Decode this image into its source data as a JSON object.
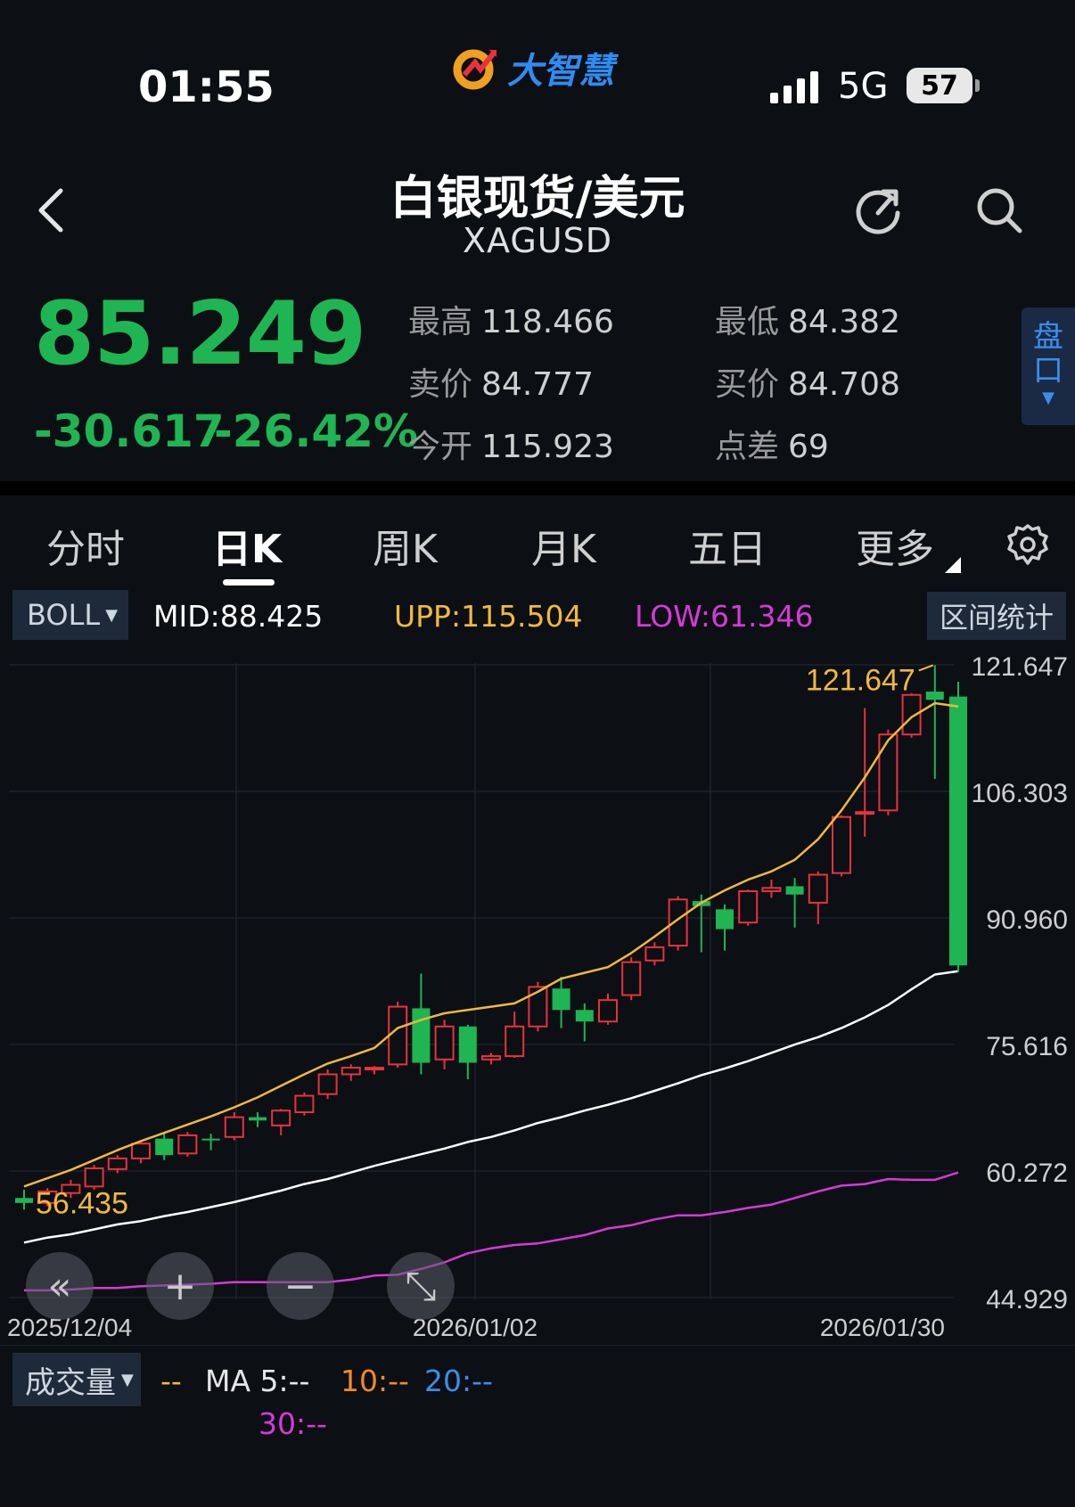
{
  "status": {
    "time": "01:55",
    "network": "5G",
    "battery": "57",
    "app_name": "大智慧"
  },
  "header": {
    "title": "白银现货/美元",
    "symbol": "XAGUSD"
  },
  "quote": {
    "price": "85.249",
    "change": "-30.617",
    "change_pct": "-26.42%",
    "stats": [
      {
        "label": "最高",
        "value": "118.466"
      },
      {
        "label": "最低",
        "value": "84.382"
      },
      {
        "label": "卖价",
        "value": "84.777"
      },
      {
        "label": "买价",
        "value": "84.708"
      },
      {
        "label": "今开",
        "value": "115.923"
      },
      {
        "label": "点差",
        "value": "69"
      }
    ],
    "pankou": [
      "盘",
      "口"
    ],
    "up_color": "#e8323c",
    "down_color": "#1fb553"
  },
  "tabs": [
    "分时",
    "日K",
    "周K",
    "月K",
    "五日",
    "更多"
  ],
  "active_tab": "日K",
  "indicator": {
    "name": "BOLL",
    "mid": "MID:88.425",
    "upp": "UPP:115.504",
    "low": "LOW:61.346",
    "range_stats": "区间统计",
    "colors": {
      "mid": "#ffffff",
      "upp": "#f0b93a",
      "low": "#d63ad6"
    }
  },
  "chart_data": {
    "type": "candlestick",
    "y_ticks": [
      "121.647",
      "106.303",
      "90.960",
      "75.616",
      "60.272",
      "44.929"
    ],
    "ylim": [
      44.929,
      121.647
    ],
    "x_labels": [
      "2025/12/04",
      "2026/01/02",
      "2026/01/30"
    ],
    "max_label": "121.647",
    "min_label": "56.435",
    "candles": [
      {
        "o": 57.0,
        "h": 58.0,
        "l": 55.6,
        "c": 56.4
      },
      {
        "o": 56.4,
        "h": 58.2,
        "l": 56.0,
        "c": 57.8
      },
      {
        "o": 57.6,
        "h": 59.2,
        "l": 57.0,
        "c": 58.6
      },
      {
        "o": 58.4,
        "h": 61.0,
        "l": 58.0,
        "c": 60.6
      },
      {
        "o": 60.5,
        "h": 62.2,
        "l": 60.0,
        "c": 61.8
      },
      {
        "o": 61.8,
        "h": 64.0,
        "l": 61.2,
        "c": 63.6
      },
      {
        "o": 64.2,
        "h": 65.0,
        "l": 61.6,
        "c": 62.2
      },
      {
        "o": 62.4,
        "h": 65.0,
        "l": 62.0,
        "c": 64.6
      },
      {
        "o": 64.2,
        "h": 64.8,
        "l": 62.8,
        "c": 64.0
      },
      {
        "o": 64.4,
        "h": 67.4,
        "l": 64.0,
        "c": 66.8
      },
      {
        "o": 66.8,
        "h": 67.4,
        "l": 65.6,
        "c": 66.4
      },
      {
        "o": 65.8,
        "h": 67.8,
        "l": 64.6,
        "c": 67.6
      },
      {
        "o": 67.4,
        "h": 69.8,
        "l": 67.0,
        "c": 69.4
      },
      {
        "o": 69.6,
        "h": 72.6,
        "l": 69.0,
        "c": 72.0
      },
      {
        "o": 72.0,
        "h": 73.2,
        "l": 71.2,
        "c": 72.8
      },
      {
        "o": 72.6,
        "h": 73.0,
        "l": 72.0,
        "c": 72.8
      },
      {
        "o": 73.2,
        "h": 80.8,
        "l": 72.8,
        "c": 80.2
      },
      {
        "o": 80.0,
        "h": 84.2,
        "l": 72.0,
        "c": 73.4
      },
      {
        "o": 73.8,
        "h": 78.6,
        "l": 72.6,
        "c": 77.8
      },
      {
        "o": 77.8,
        "h": 78.0,
        "l": 71.4,
        "c": 73.4
      },
      {
        "o": 73.8,
        "h": 74.6,
        "l": 73.2,
        "c": 74.2
      },
      {
        "o": 74.2,
        "h": 79.6,
        "l": 74.0,
        "c": 77.8
      },
      {
        "o": 77.8,
        "h": 83.2,
        "l": 77.2,
        "c": 82.6
      },
      {
        "o": 82.4,
        "h": 83.8,
        "l": 77.6,
        "c": 79.8
      },
      {
        "o": 79.8,
        "h": 80.6,
        "l": 76.0,
        "c": 78.4
      },
      {
        "o": 78.4,
        "h": 81.8,
        "l": 78.0,
        "c": 81.0
      },
      {
        "o": 81.6,
        "h": 86.2,
        "l": 81.0,
        "c": 85.6
      },
      {
        "o": 85.8,
        "h": 88.0,
        "l": 85.2,
        "c": 87.4
      },
      {
        "o": 87.6,
        "h": 93.6,
        "l": 87.0,
        "c": 93.2
      },
      {
        "o": 93.0,
        "h": 93.8,
        "l": 86.8,
        "c": 92.4
      },
      {
        "o": 92.0,
        "h": 92.6,
        "l": 87.0,
        "c": 89.6
      },
      {
        "o": 90.4,
        "h": 94.4,
        "l": 90.0,
        "c": 94.2
      },
      {
        "o": 94.2,
        "h": 95.6,
        "l": 93.4,
        "c": 94.6
      },
      {
        "o": 94.8,
        "h": 95.8,
        "l": 89.8,
        "c": 93.8
      },
      {
        "o": 92.8,
        "h": 96.6,
        "l": 90.2,
        "c": 96.2
      },
      {
        "o": 96.4,
        "h": 103.4,
        "l": 96.0,
        "c": 103.2
      },
      {
        "o": 103.6,
        "h": 116.4,
        "l": 100.8,
        "c": 103.8
      },
      {
        "o": 104.0,
        "h": 113.8,
        "l": 103.4,
        "c": 113.2
      },
      {
        "o": 113.2,
        "h": 118.2,
        "l": 112.8,
        "c": 118.0
      },
      {
        "o": 118.4,
        "h": 121.6,
        "l": 107.8,
        "c": 117.4
      },
      {
        "o": 117.8,
        "h": 119.6,
        "l": 84.4,
        "c": 85.2
      }
    ],
    "upp": [
      58.4,
      59.4,
      60.4,
      61.6,
      62.8,
      63.9,
      64.9,
      65.9,
      66.9,
      68.0,
      69.2,
      70.6,
      72.0,
      73.3,
      74.2,
      75.2,
      77.6,
      78.6,
      79.4,
      79.8,
      80.2,
      80.6,
      82.0,
      83.6,
      84.3,
      85.0,
      86.7,
      88.7,
      90.8,
      92.8,
      94.3,
      95.6,
      96.6,
      98.0,
      100.5,
      104.0,
      108.0,
      112.5,
      115.3,
      117.0,
      116.6
    ],
    "mid": [
      51.6,
      52.2,
      52.6,
      53.2,
      53.8,
      54.2,
      54.8,
      55.3,
      55.9,
      56.5,
      57.2,
      57.9,
      58.7,
      59.3,
      60.1,
      60.9,
      61.6,
      62.3,
      63.0,
      63.8,
      64.4,
      65.2,
      66.1,
      66.8,
      67.6,
      68.3,
      69.1,
      70.0,
      70.9,
      71.9,
      72.7,
      73.6,
      74.6,
      75.6,
      76.5,
      77.6,
      78.9,
      80.4,
      82.3,
      84.1,
      84.5
    ],
    "low": [
      45.8,
      45.8,
      45.9,
      46.1,
      46.1,
      46.3,
      46.4,
      46.5,
      46.6,
      46.8,
      46.8,
      46.8,
      46.8,
      46.8,
      47.1,
      47.6,
      47.7,
      48.4,
      49.2,
      50.3,
      50.9,
      51.3,
      51.5,
      52.0,
      52.5,
      53.3,
      53.7,
      54.4,
      54.9,
      54.9,
      55.3,
      55.8,
      56.2,
      57.0,
      57.8,
      58.5,
      58.7,
      59.3,
      59.2,
      59.2,
      60.1
    ]
  },
  "zoom_controls": [
    "«",
    "+",
    "−",
    "⤡"
  ],
  "volume": {
    "name": "成交量",
    "ma_prefix": "--",
    "ma5": "MA 5:--",
    "ma10": "10:--",
    "ma20": "20:--",
    "ma30": "30:--",
    "colors": {
      "ma5": "#e6e6e6",
      "ma10": "#f08a24",
      "ma20": "#3b8eea",
      "ma30": "#d63ad6"
    }
  }
}
